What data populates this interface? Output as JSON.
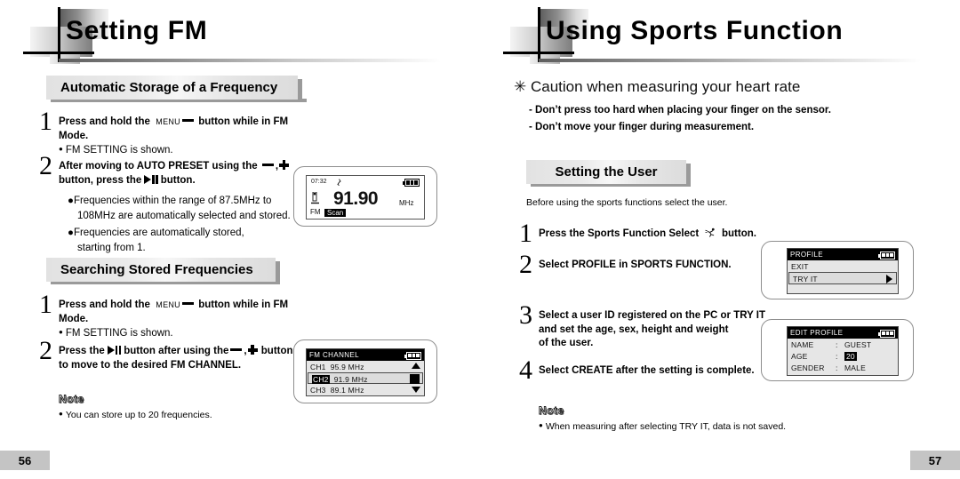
{
  "left_page": {
    "chapter_title": "Setting FM",
    "page_number": "56",
    "sections": [
      {
        "heading": "Automatic Storage of a Frequency"
      },
      {
        "heading": "Searching Stored Frequencies"
      }
    ],
    "s1_step1": {
      "num": "1",
      "text_before": "Press and hold the",
      "menu_label": "MENU",
      "text_after": "button while in FM Mode.",
      "bullet": "FM SETTING is shown."
    },
    "s1_step2": {
      "num": "2",
      "line1_a": "After moving to AUTO PRESET using the",
      "line1_b": ",",
      "line2_a": "button, press the",
      "line2_b": "button.",
      "bullets": [
        "Frequencies within the range of 87.5MHz to",
        "108MHz are automatically selected and stored.",
        "Frequencies are automatically stored,",
        "starting from 1."
      ]
    },
    "s2_step1": {
      "num": "1",
      "text_before": "Press and hold the",
      "menu_label": "MENU",
      "text_after": "button while in FM Mode.",
      "bullet": "FM SETTING is shown."
    },
    "s2_step2": {
      "num": "2",
      "line1_a": "Press the",
      "line1_b": "button after using the",
      "line1_c": ",",
      "line1_d": "buttons",
      "line2": "to move to the desired FM CHANNEL."
    },
    "note": {
      "title": "Note",
      "items": [
        "You can store up to 20 frequencies."
      ]
    },
    "fm_display": {
      "time": "07:32",
      "frequency": "91.90",
      "unit": "MHz",
      "mode": "FM",
      "status": "Scan"
    },
    "fm_channel_display": {
      "title": "FM CHANNEL",
      "rows": [
        {
          "ch": "CH1",
          "freq": "95.9 MHz",
          "marker": "up"
        },
        {
          "ch": "CH2",
          "freq": "91.9 MHz",
          "marker": "block",
          "selected": true
        },
        {
          "ch": "CH3",
          "freq": "89.1 MHz",
          "marker": "down"
        }
      ]
    }
  },
  "right_page": {
    "chapter_title": "Using Sports Function",
    "page_number": "57",
    "caution_title": "✳ Caution when measuring your heart rate",
    "caution_lines": [
      "- Don’t press too hard when placing your finger on the sensor.",
      "- Don’t move your finger during measurement."
    ],
    "section_heading": "Setting the User",
    "intro": "Before using the sports functions select the user.",
    "steps": [
      {
        "num": "1",
        "line1_a": "Press the Sports Function Select",
        "line1_b": "button.",
        "has_icon": true
      },
      {
        "num": "2",
        "lines": [
          "Select PROFILE in SPORTS FUNCTION."
        ]
      },
      {
        "num": "3",
        "lines": [
          "Select a user ID registered on the PC or TRY IT",
          "and set the age, sex, height and weight",
          "of the user."
        ]
      },
      {
        "num": "4",
        "lines": [
          "Select CREATE after the setting is complete."
        ]
      }
    ],
    "note": {
      "title": "Note",
      "items": [
        "When measuring after selecting TRY IT, data is not saved."
      ]
    },
    "profile_display": {
      "title": "PROFILE",
      "rows": [
        {
          "label": "EXIT",
          "boxed": false,
          "marker": "none"
        },
        {
          "label": "TRY IT",
          "boxed": true,
          "marker": "right"
        }
      ]
    },
    "edit_profile_display": {
      "title": "EDIT PROFILE",
      "rows": [
        {
          "label": "NAME",
          "sep": ":",
          "value": "GUEST",
          "highlight": false
        },
        {
          "label": "AGE",
          "sep": ":",
          "value": "20",
          "highlight": true
        },
        {
          "label": "GENDER",
          "sep": ":",
          "value": "MALE",
          "highlight": false
        }
      ]
    }
  },
  "colors": {
    "page_bg": "#ffffff",
    "header_gray": "#8f8f8f",
    "section_bar": "#e6e6e6",
    "shadow_gray": "#9a9a9a",
    "pagenum_bg": "#c4c4c4",
    "lcd_bg": "#e6e6e6",
    "lcd_border": "#4a4a4a"
  }
}
